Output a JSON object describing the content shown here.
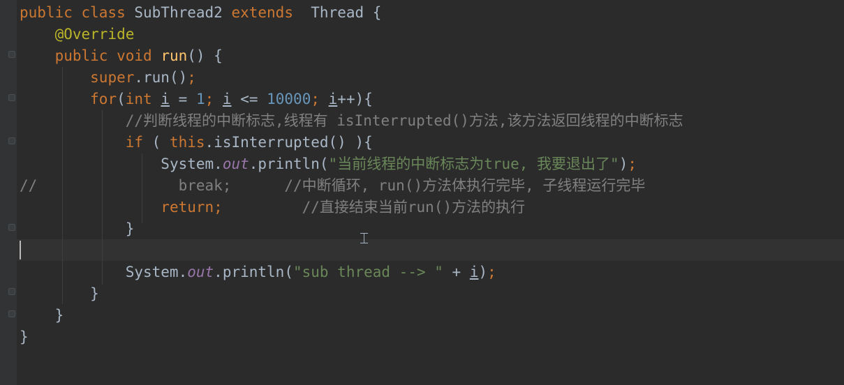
{
  "code": {
    "l1_kw": "public class",
    "l1_name": "SubThread2",
    "l1_ext": "extends",
    "l1_super": "Thread",
    "l1_brace": "{",
    "l2_ann": "@Override",
    "l3_kw": "public void",
    "l3_fn": "run",
    "l3_rest": "() {",
    "l4_super": "super",
    "l4_rest": ".run()",
    "l4_semi": ";",
    "l5_for": "for",
    "l5_open": "(",
    "l5_int": "int",
    "l5_i1": "i",
    "l5_eq": " = ",
    "l5_one": "1",
    "l5_semi1": "; ",
    "l5_i2": "i",
    "l5_le": " <= ",
    "l5_max": "10000",
    "l5_semi2": "; ",
    "l5_i3": "i",
    "l5_inc": "++){",
    "l6_comment": "//判断线程的中断标志,线程有 isInterrupted()方法,该方法返回线程的中断标志",
    "l7_if": "if",
    "l7_open": " ( ",
    "l7_this": "this",
    "l7_rest": ".isInterrupted() ){",
    "l8_sys": "System.",
    "l8_out": "out",
    "l8_println": ".println(",
    "l8_str": "\"当前线程的中断标志为true, 我要退出了\"",
    "l8_close": ")",
    "l8_semi": ";",
    "l9_prefix": "//",
    "l9_break": "break;",
    "l9_comment": "//中断循环, run()方法体执行完毕, 子线程运行完毕",
    "l10_return": "return;",
    "l10_comment": "//直接结束当前run()方法的执行",
    "l11_brace": "}",
    "l13_sys": "System.",
    "l13_out": "out",
    "l13_println": ".println(",
    "l13_str": "\"sub thread --> \"",
    "l13_plus": " + ",
    "l13_i": "i",
    "l13_close": ")",
    "l13_semi": ";",
    "l14_brace": "}",
    "l15_brace": "}",
    "l16_brace": "}"
  },
  "colors": {
    "background": "#2b2b2b",
    "keyword": "#cc7832",
    "annotation": "#bbb529",
    "function": "#ffc66d",
    "number": "#6897bb",
    "string": "#6a8759",
    "comment": "#808080",
    "field": "#9876aa",
    "default": "#a9b7c6"
  }
}
